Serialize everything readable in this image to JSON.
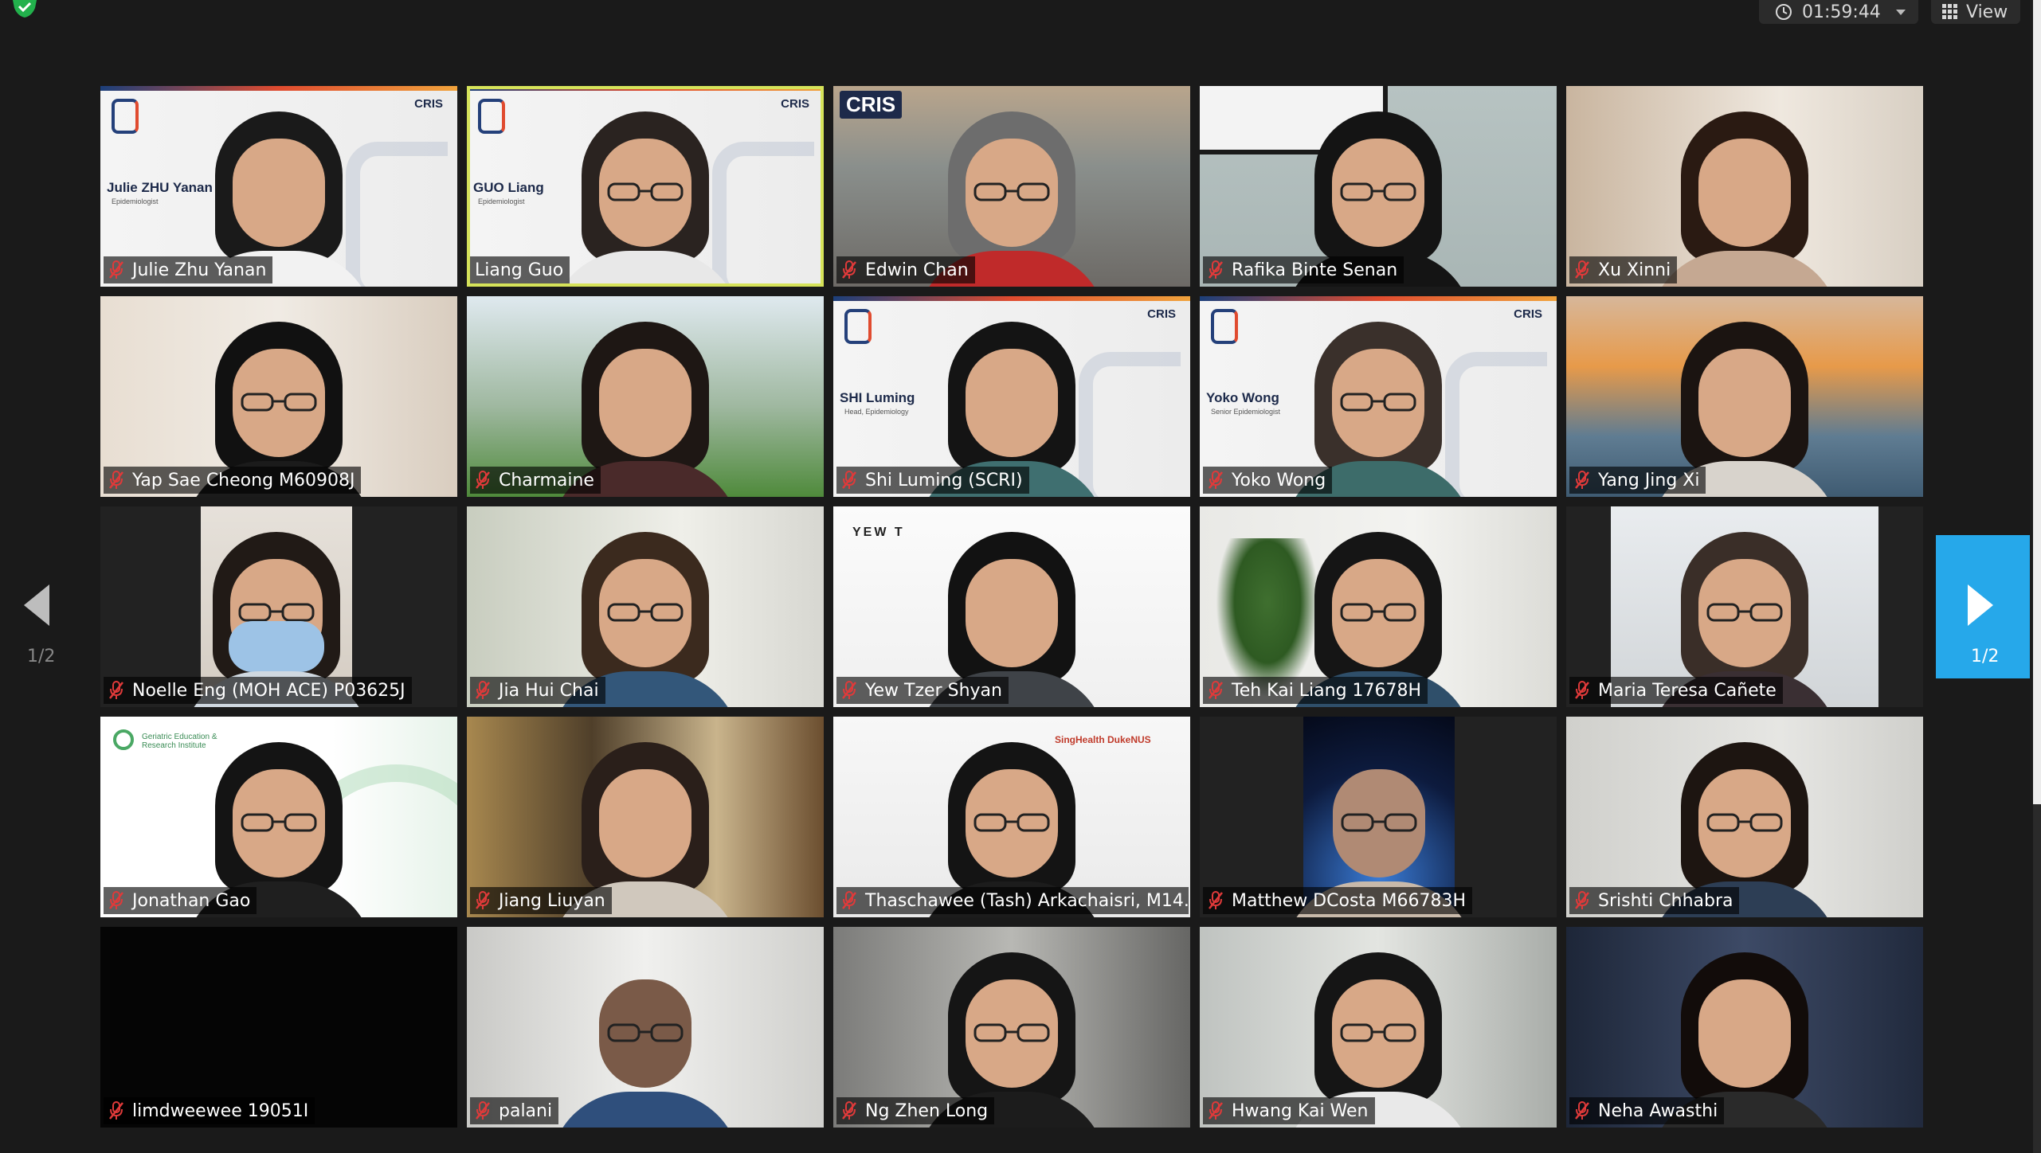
{
  "topbar": {
    "timer": "01:59:44",
    "view_label": "View",
    "icons": [
      "shield-check-icon",
      "clock-icon",
      "chevron-down-icon",
      "grid-view-icon"
    ],
    "accent": "#22b14c"
  },
  "pagination": {
    "prev_label": "1/2",
    "next_label": "1/2",
    "next_color": "#26a8ea"
  },
  "participants": [
    {
      "name": "Julie Zhu Yanan",
      "muted": true,
      "slide_name": "Julie ZHU Yanan",
      "slide_role": "Epidemiologist",
      "brand": "CRIS"
    },
    {
      "name": "Liang Guo",
      "muted": false,
      "active": true,
      "slide_name": "GUO Liang",
      "slide_role": "Epidemiologist",
      "brand": "CRIS"
    },
    {
      "name": "Edwin Chan",
      "muted": true,
      "brand": "CRIS"
    },
    {
      "name": "Rafika Binte Senan",
      "muted": true
    },
    {
      "name": "Xu Xinni",
      "muted": true
    },
    {
      "name": "Yap Sae Cheong M60908J",
      "muted": true
    },
    {
      "name": "Charmaine",
      "muted": true
    },
    {
      "name": "Shi Luming (SCRI)",
      "muted": true,
      "slide_name": "SHI Luming",
      "slide_role": "Head, Epidemiology",
      "brand": "CRIS"
    },
    {
      "name": "Yoko Wong",
      "muted": true,
      "slide_name": "Yoko Wong",
      "slide_role": "Senior Epidemiologist",
      "brand": "CRIS"
    },
    {
      "name": "Yang Jing Xi",
      "muted": true
    },
    {
      "name": "Noelle Eng (MOH ACE) P03625J",
      "muted": true
    },
    {
      "name": "Jia Hui Chai",
      "muted": true
    },
    {
      "name": "Yew Tzer Shyan",
      "muted": true,
      "bg_text": "YEW T"
    },
    {
      "name": "Teh Kai Liang 17678H",
      "muted": true
    },
    {
      "name": "Maria Teresa Cañete",
      "muted": true
    },
    {
      "name": "Jonathan Gao",
      "muted": true,
      "org": "Geriatric Education & Research Institute"
    },
    {
      "name": "Jiang Liuyan",
      "muted": true
    },
    {
      "name": "Thaschawee (Tash) Arkachaisri, M14...",
      "muted": true,
      "org": "SingHealth DukeNUS"
    },
    {
      "name": "Matthew DCosta M66783H",
      "muted": true
    },
    {
      "name": "Srishti Chhabra",
      "muted": true
    },
    {
      "name": "limdweewee 19051I",
      "muted": true
    },
    {
      "name": "palani",
      "muted": true
    },
    {
      "name": "Ng Zhen Long",
      "muted": true
    },
    {
      "name": "Hwang Kai Wen",
      "muted": true
    },
    {
      "name": "Neha Awasthi",
      "muted": true
    }
  ]
}
